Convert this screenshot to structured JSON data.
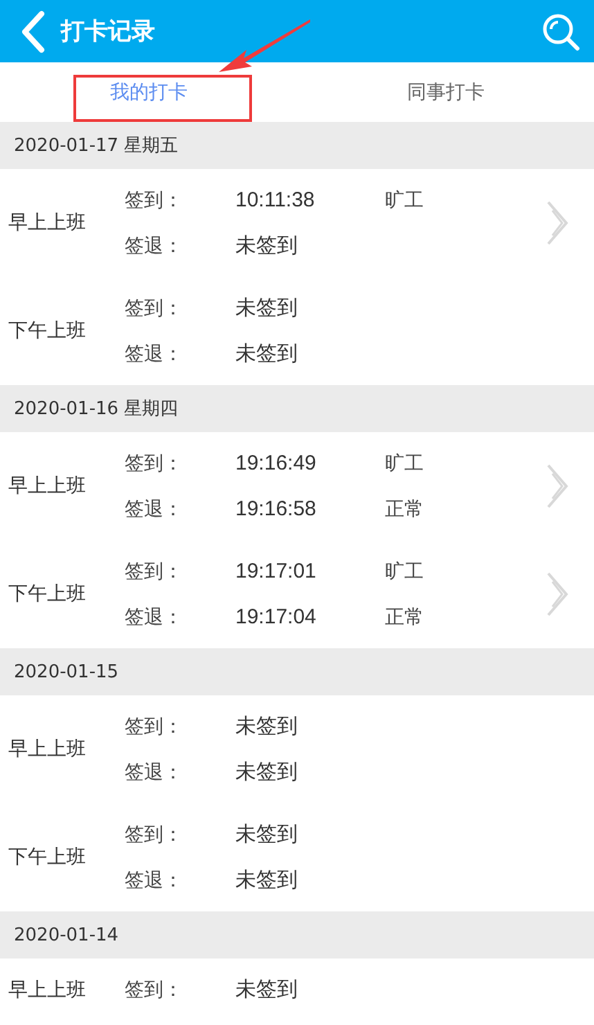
{
  "header": {
    "title": "打卡记录"
  },
  "tabs": [
    {
      "label": "我的打卡",
      "selected": true
    },
    {
      "label": "同事打卡",
      "selected": false
    }
  ],
  "days": [
    {
      "date": "2020-01-17 星期五",
      "shifts": [
        {
          "name": "早上上班",
          "arrow": true,
          "rows": [
            {
              "label": "签到：",
              "time": "10:11:38",
              "status": "旷工"
            },
            {
              "label": "签退：",
              "time": "未签到"
            }
          ]
        },
        {
          "name": "下午上班",
          "arrow": false,
          "rows": [
            {
              "label": "签到：",
              "time": "未签到"
            },
            {
              "label": "签退：",
              "time": "未签到"
            }
          ]
        }
      ]
    },
    {
      "date": "2020-01-16 星期四",
      "shifts": [
        {
          "name": "早上上班",
          "arrow": true,
          "rows": [
            {
              "label": "签到：",
              "time": "19:16:49",
              "status": "旷工"
            },
            {
              "label": "签退：",
              "time": "19:16:58",
              "status": "正常"
            }
          ]
        },
        {
          "name": "下午上班",
          "arrow": true,
          "rows": [
            {
              "label": "签到：",
              "time": "19:17:01",
              "status": "旷工"
            },
            {
              "label": "签退：",
              "time": "19:17:04",
              "status": "正常"
            }
          ]
        }
      ]
    },
    {
      "date": "2020-01-15",
      "shifts": [
        {
          "name": "早上上班",
          "arrow": false,
          "rows": [
            {
              "label": "签到：",
              "time": "未签到"
            },
            {
              "label": "签退：",
              "time": "未签到"
            }
          ]
        },
        {
          "name": "下午上班",
          "arrow": false,
          "rows": [
            {
              "label": "签到：",
              "time": "未签到"
            },
            {
              "label": "签退：",
              "time": "未签到"
            }
          ]
        }
      ]
    },
    {
      "date": "2020-01-14",
      "shifts": [
        {
          "name": "早上上班",
          "arrow": false,
          "rows": [
            {
              "label": "签到：",
              "time": "未签到"
            }
          ]
        }
      ]
    }
  ],
  "annotation": {
    "kind": "highlight-arrow"
  }
}
